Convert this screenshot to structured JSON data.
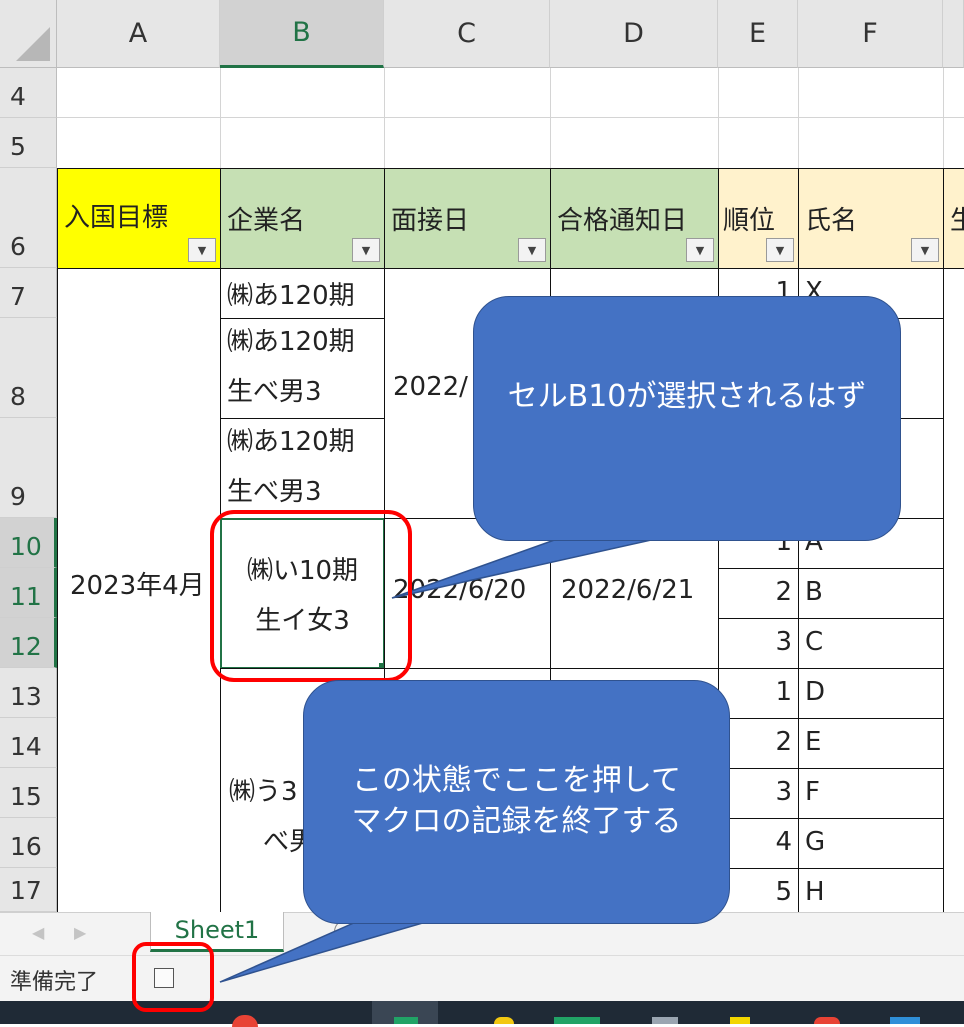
{
  "columns": [
    {
      "label": "A",
      "selected": false
    },
    {
      "label": "B",
      "selected": true
    },
    {
      "label": "C",
      "selected": false
    },
    {
      "label": "D",
      "selected": false
    },
    {
      "label": "E",
      "selected": false
    },
    {
      "label": "F",
      "selected": false
    }
  ],
  "rows": [
    {
      "label": "4",
      "selected": false
    },
    {
      "label": "5",
      "selected": false
    },
    {
      "label": "6",
      "selected": false
    },
    {
      "label": "7",
      "selected": false
    },
    {
      "label": "8",
      "selected": false
    },
    {
      "label": "9",
      "selected": false
    },
    {
      "label": "10",
      "selected": true
    },
    {
      "label": "11",
      "selected": true
    },
    {
      "label": "12",
      "selected": true
    },
    {
      "label": "13",
      "selected": false
    },
    {
      "label": "14",
      "selected": false
    },
    {
      "label": "15",
      "selected": false
    },
    {
      "label": "16",
      "selected": false
    },
    {
      "label": "17",
      "selected": false
    }
  ],
  "table_headers": {
    "a": "入国目標",
    "b": "企業名",
    "c": "面接日",
    "d": "合格通知日",
    "e": "順位",
    "f": "氏名",
    "g": "生"
  },
  "cells": {
    "a7_17": "2023年4月",
    "b7": "㈱あ120期",
    "b8_l1": "㈱あ120期",
    "b8_l2": "生べ男3",
    "b9_l1": "㈱あ120期",
    "b9_l2": "生べ男3",
    "b10_l1": "㈱い10期",
    "b10_l2": "生イ女3",
    "b13_partial_l1": "㈱う3",
    "b13_partial_l2": "べ男",
    "c8_9": "2022/",
    "c10_12": "2022/6/20",
    "d10_12": "2022/6/21",
    "e7": "1",
    "e10": "1",
    "e11": "2",
    "e12": "3",
    "e13": "1",
    "e14": "2",
    "e15": "3",
    "e16": "4",
    "e17": "5",
    "f7": "X",
    "f10": "A",
    "f11": "B",
    "f12": "C",
    "f13": "D",
    "f14": "E",
    "f15": "F",
    "f16": "G",
    "f17": "H"
  },
  "callouts": {
    "top": "セルB10が選択されるはず",
    "bottom_l1": "この状態でここを押して",
    "bottom_l2": "マクロの記録を終了する"
  },
  "sheet_tab": "Sheet1",
  "status": {
    "ready": "準備完了",
    "macro_stop_icon": "stop-recording-icon"
  },
  "colors": {
    "yellow": "#ffff00",
    "green": "#c6e0b4",
    "peach": "#fff2cc",
    "callout": "#4472c4",
    "highlight": "#ff0000",
    "excel_green": "#217346"
  }
}
